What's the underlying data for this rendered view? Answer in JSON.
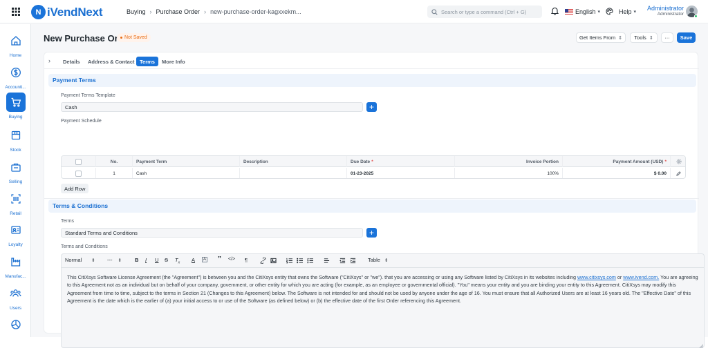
{
  "app": {
    "name": "iVendNext",
    "logo_letter": "N"
  },
  "breadcrumb": [
    "Buying",
    "Purchase Order",
    "new-purchase-order-kagxxekm..."
  ],
  "search": {
    "placeholder": "Search or type a command (Ctrl + G)"
  },
  "navbar": {
    "language": "English",
    "help": "Help",
    "user_name": "Administrator",
    "user_role": "Administrator"
  },
  "sidebar": {
    "items": [
      {
        "label": "Home",
        "icon": "home-icon"
      },
      {
        "label": "Accounti...",
        "icon": "accounting-icon"
      },
      {
        "label": "Buying",
        "icon": "cart-icon",
        "active": true
      },
      {
        "label": "Stock",
        "icon": "box-icon"
      },
      {
        "label": "Selling",
        "icon": "selling-icon"
      },
      {
        "label": "Retail",
        "icon": "barcode-icon"
      },
      {
        "label": "Loyalty",
        "icon": "loyalty-icon"
      },
      {
        "label": "Manufac...",
        "icon": "factory-icon"
      },
      {
        "label": "Users",
        "icon": "users-icon"
      },
      {
        "label": "",
        "icon": "chart-icon"
      }
    ]
  },
  "page": {
    "title": "New Purchase Order",
    "status": "Not Saved"
  },
  "toolbar": {
    "get_items": "Get Items From",
    "tools": "Tools",
    "more": "···",
    "save": "Save"
  },
  "tabs": [
    {
      "label": "Details"
    },
    {
      "label": "Address & Contact"
    },
    {
      "label": "Terms",
      "active": true
    },
    {
      "label": "More Info"
    }
  ],
  "payment_terms": {
    "section_title": "Payment Terms",
    "template_label": "Payment Terms Template",
    "template_value": "Cash",
    "schedule_label": "Payment Schedule",
    "columns": {
      "no": "No.",
      "term": "Payment Term",
      "description": "Description",
      "due_date": "Due Date",
      "portion": "Invoice Portion",
      "amount": "Payment Amount (USD)"
    },
    "rows": [
      {
        "no": "1",
        "term": "Cash",
        "description": "",
        "due_date": "01-23-2025",
        "portion": "100%",
        "amount": "$ 0.00"
      }
    ],
    "add_row": "Add Row"
  },
  "terms": {
    "section_title": "Terms & Conditions",
    "terms_label": "Terms",
    "terms_value": "Standard Terms and Conditions",
    "editor_label": "Terms and Conditions",
    "editor_toolbar": {
      "style": "Normal",
      "size": "---",
      "table": "Table"
    },
    "text_part1": "This CitiXsys Software License Agreement (the \"Agreement\") is between you and the CitiXsys entity that owns the Software (\"CitiXsys\" or \"we\"). that you are accessing or using any Software listed by CitiXsys in its websites including ",
    "link1": "www.citixsys.com",
    "text_or": " or ",
    "link2": "www.ivend.com.",
    "text_part2": " You are agreeing to this Agreement not as an individual but on behalf of your company, government, or other entity for which you are acting (for example, as an employee or governmental official). \"You\" means your entity and you are binding your entity to this Agreement. CitiXsys may modify this Agreement from time to time, subject to the terms in Section 21 (Changes to this Agreement) below. The Software is not intended for and should not be used by anyone under the age of 16. You must ensure that all Authorized Users are at least 16 years old. The \"Effective Date\" of this Agreement is the date which is the earlier of (a) your initial access to or use of the Software (as defined below) or (b) the effective date of the first Order referencing this Agreement."
  },
  "colors": {
    "primary": "#1a73d9",
    "status": "#e86c13",
    "section_bg": "#eef4fc"
  }
}
